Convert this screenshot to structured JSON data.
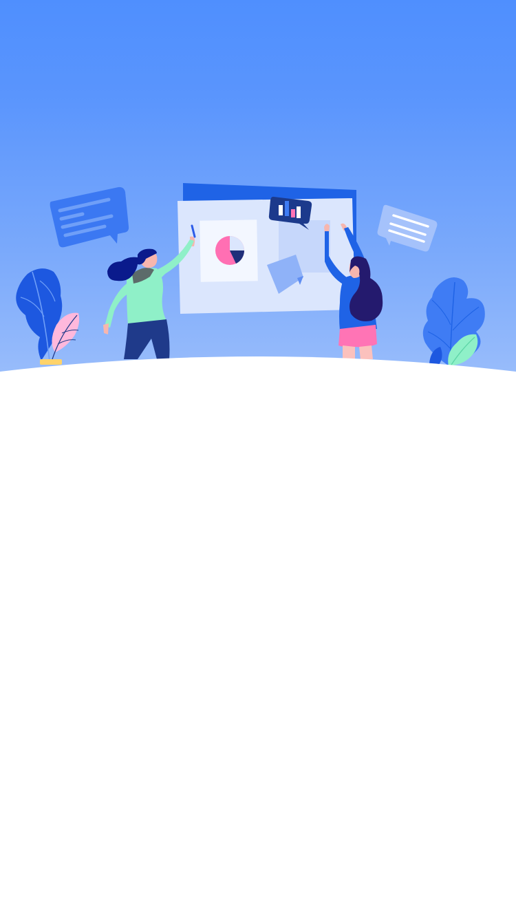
{
  "screen": {
    "background_color": "#ffffff"
  },
  "hero": {
    "gradient_top": "#4f8ffe",
    "gradient_bottom": "#9bbefb",
    "illustration": "team-collaboration-dashboard",
    "icons": [
      "chat-bubble-icon",
      "bar-chart-icon",
      "pie-chart-icon",
      "sticky-note-icon",
      "leaf-plant-icon"
    ]
  },
  "colors": {
    "board_back": "#1f63e6",
    "board_front": "#dbe6fd",
    "pie_pink": "#ff6fb3",
    "pie_navy": "#1f2f7a",
    "shirt_mint": "#8ff0c8",
    "pants_navy": "#1f3a8a",
    "hair_dark": "#0a1a8c",
    "shorts_pink": "#ff74b5",
    "leaf_blue": "#1d58e0",
    "leaf_pink": "#ffb8dc"
  }
}
